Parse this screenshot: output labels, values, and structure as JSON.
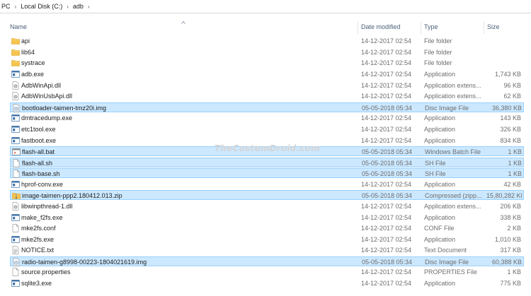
{
  "breadcrumb": [
    "PC",
    "Local Disk (C:)",
    "adb"
  ],
  "columns": {
    "name": "Name",
    "date": "Date modified",
    "type": "Type",
    "size": "Size"
  },
  "watermark": "TheCustomDroid.com",
  "files": [
    {
      "name": "api",
      "date": "14-12-2017 02:54",
      "type": "File folder",
      "size": "",
      "icon": "folder-icon",
      "selected": false
    },
    {
      "name": "lib64",
      "date": "14-12-2017 02:54",
      "type": "File folder",
      "size": "",
      "icon": "folder-icon",
      "selected": false
    },
    {
      "name": "systrace",
      "date": "14-12-2017 02:54",
      "type": "File folder",
      "size": "",
      "icon": "folder-icon",
      "selected": false
    },
    {
      "name": "adb.exe",
      "date": "14-12-2017 02:54",
      "type": "Application",
      "size": "1,743 KB",
      "icon": "exe-icon",
      "selected": false
    },
    {
      "name": "AdbWinApi.dll",
      "date": "14-12-2017 02:54",
      "type": "Application extens...",
      "size": "96 KB",
      "icon": "dll-icon",
      "selected": false
    },
    {
      "name": "AdbWinUsbApi.dll",
      "date": "14-12-2017 02:54",
      "type": "Application extens...",
      "size": "62 KB",
      "icon": "dll-icon",
      "selected": false
    },
    {
      "name": "bootloader-taimen-tmz20i.img",
      "date": "05-05-2018 05:34",
      "type": "Disc Image File",
      "size": "36,380 KB",
      "icon": "disc-image-icon",
      "selected": true
    },
    {
      "name": "dmtracedump.exe",
      "date": "14-12-2017 02:54",
      "type": "Application",
      "size": "143 KB",
      "icon": "exe-icon",
      "selected": false
    },
    {
      "name": "etc1tool.exe",
      "date": "14-12-2017 02:54",
      "type": "Application",
      "size": "326 KB",
      "icon": "exe-icon",
      "selected": false
    },
    {
      "name": "fastboot.exe",
      "date": "14-12-2017 02:54",
      "type": "Application",
      "size": "834 KB",
      "icon": "exe-icon",
      "selected": false
    },
    {
      "name": "flash-all.bat",
      "date": "05-05-2018 05:34",
      "type": "Windows Batch File",
      "size": "1 KB",
      "icon": "batch-file-icon",
      "selected": true
    },
    {
      "name": "flash-all.sh",
      "date": "05-05-2018 05:34",
      "type": "SH File",
      "size": "1 KB",
      "icon": "file-icon",
      "selected": true
    },
    {
      "name": "flash-base.sh",
      "date": "05-05-2018 05:34",
      "type": "SH File",
      "size": "1 KB",
      "icon": "file-icon",
      "selected": true
    },
    {
      "name": "hprof-conv.exe",
      "date": "14-12-2017 02:54",
      "type": "Application",
      "size": "42 KB",
      "icon": "exe-icon",
      "selected": false
    },
    {
      "name": "image-taimen-ppp2.180412.013.zip",
      "date": "05-05-2018 05:34",
      "type": "Compressed (zipp...",
      "size": "15,80,282 KB",
      "icon": "zip-icon",
      "selected": true
    },
    {
      "name": "libwinpthread-1.dll",
      "date": "14-12-2017 02:54",
      "type": "Application extens...",
      "size": "206 KB",
      "icon": "dll-icon",
      "selected": false
    },
    {
      "name": "make_f2fs.exe",
      "date": "14-12-2017 02:54",
      "type": "Application",
      "size": "338 KB",
      "icon": "exe-icon",
      "selected": false
    },
    {
      "name": "mke2fs.conf",
      "date": "14-12-2017 02:54",
      "type": "CONF File",
      "size": "2 KB",
      "icon": "file-icon",
      "selected": false
    },
    {
      "name": "mke2fs.exe",
      "date": "14-12-2017 02:54",
      "type": "Application",
      "size": "1,010 KB",
      "icon": "exe-icon",
      "selected": false
    },
    {
      "name": "NOTICE.txt",
      "date": "14-12-2017 02:54",
      "type": "Text Document",
      "size": "317 KB",
      "icon": "text-file-icon",
      "selected": false
    },
    {
      "name": "radio-taimen-g8998-00223-1804021619.img",
      "date": "05-05-2018 05:34",
      "type": "Disc Image File",
      "size": "60,388 KB",
      "icon": "disc-image-icon",
      "selected": true
    },
    {
      "name": "source.properties",
      "date": "14-12-2017 02:54",
      "type": "PROPERTIES File",
      "size": "1 KB",
      "icon": "file-icon",
      "selected": false
    },
    {
      "name": "sqlite3.exe",
      "date": "14-12-2017 02:54",
      "type": "Application",
      "size": "775 KB",
      "icon": "exe-icon",
      "selected": false
    }
  ]
}
